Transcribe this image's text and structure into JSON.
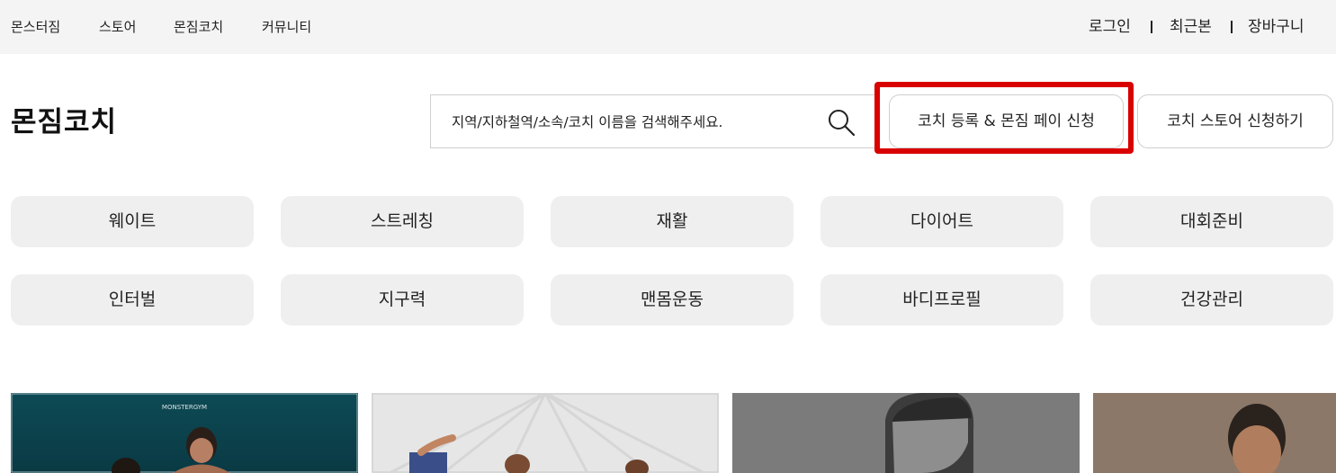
{
  "top_nav": {
    "items": [
      "몬스터짐",
      "스토어",
      "몬짐코치",
      "커뮤니티"
    ],
    "right_links": [
      "로그인",
      "최근본",
      "장바구니"
    ]
  },
  "page": {
    "title": "몬짐코치"
  },
  "search": {
    "placeholder": "지역/지하철역/소속/코치 이름을 검색해주세요.",
    "icon": "search-icon"
  },
  "buttons": {
    "register": "코치 등록 & 몬짐 페이 신청",
    "store_apply": "코치 스토어 신청하기"
  },
  "colors": {
    "topbar_bg": "#f4f4f4",
    "chip_bg": "#efefef",
    "highlight": "#d90000"
  },
  "categories": {
    "row1": [
      "웨이트",
      "스트레칭",
      "재활",
      "다이어트",
      "대회준비"
    ],
    "row2": [
      "인터벌",
      "지구력",
      "맨몸운동",
      "바디프로필",
      "건강관리"
    ]
  },
  "cards": {
    "card1_logo": "MONSTERGYM"
  }
}
